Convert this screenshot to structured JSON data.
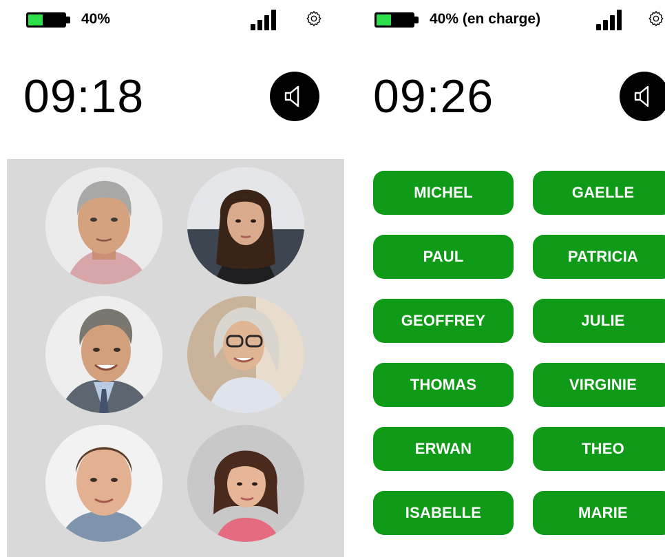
{
  "left_screen": {
    "battery": {
      "text": "40%",
      "level_percent": 40,
      "color": "#2de04a"
    },
    "clock": "09:18",
    "contacts": [
      {
        "icon": "man-grey-hair-photo"
      },
      {
        "icon": "woman-dark-hair-photo"
      },
      {
        "icon": "man-smiling-suit-photo"
      },
      {
        "icon": "woman-glasses-photo"
      },
      {
        "icon": "young-man-photo"
      },
      {
        "icon": "woman-bob-hair-photo"
      }
    ]
  },
  "right_screen": {
    "battery": {
      "text": "40% (en charge)",
      "level_percent": 40,
      "color": "#2de04a"
    },
    "clock": "09:26",
    "names": [
      "MICHEL",
      "GAELLE",
      "PAUL",
      "PATRICIA",
      "GEOFFREY",
      "JULIE",
      "THOMAS",
      "VIRGINIE",
      "ERWAN",
      "THEO",
      "ISABELLE",
      "MARIE"
    ]
  },
  "icons": {
    "signal": "signal-icon",
    "settings": "gear-icon",
    "speaker": "speaker-icon"
  },
  "colors": {
    "name_button": "#0f9a17",
    "photo_grid_bg": "#d9d9d9"
  }
}
